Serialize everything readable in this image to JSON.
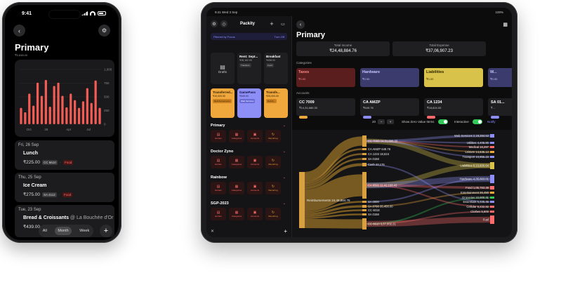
{
  "phone": {
    "status_time": "9:41",
    "title": "Primary",
    "subtitle": "₹5,638.00",
    "chart_data": {
      "type": "bar",
      "y_ticks": [
        "1,000",
        "750",
        "500",
        "250",
        "0"
      ],
      "x_ticks": [
        "Oct",
        "28",
        "Apr",
        "Jul"
      ],
      "values": [
        300,
        220,
        560,
        340,
        760,
        520,
        810,
        320,
        700,
        760,
        520,
        310,
        560,
        440,
        300,
        420,
        660,
        390,
        800,
        300
      ]
    },
    "transactions": [
      {
        "date": "Fri, 26 Sep",
        "name": "Lunch",
        "merchant": "",
        "amount": "₹225.00",
        "account": "CC 6610",
        "category": "Food"
      },
      {
        "date": "Thu, 25 Sep",
        "name": "Ice Cream",
        "merchant": "",
        "amount": "₹275.00",
        "account": "SA 4112",
        "category": "Food"
      },
      {
        "date": "Tue, 23 Sep",
        "name": "Bread & Croissants",
        "merchant": "@ La Bouchée d'Or",
        "amount": "₹439.00",
        "account": "",
        "category": ""
      }
    ],
    "tabs": [
      "All",
      "Month",
      "Week"
    ],
    "add_label": "+"
  },
  "tablet": {
    "status_time": "9:41",
    "status_date": "Wed 3 Sep",
    "status_battery": "100%",
    "sidebar": {
      "title": "Packity",
      "filter_label": "Filtered by Focus",
      "filter_off": "Turn Off",
      "drafts_label": "Drafts",
      "tiles_row1": [
        {
          "name": "Rent: Sept...",
          "amount": "₹28,162.00",
          "pill": "Transfers"
        },
        {
          "name": "Breakfast",
          "amount": "₹408.00",
          "pill": "Food"
        }
      ],
      "tiles_row2": [
        {
          "name": "Transferred...",
          "amount": "₹10,000.00",
          "pill": "Reimbursements",
          "style": "orange"
        },
        {
          "name": "GamePass",
          "amount": "₹349.00",
          "pill": "Web Services",
          "style": "purple"
        },
        {
          "name": "Transfe...",
          "amount": "₹25,000.00",
          "pill": "Reimb...",
          "style": "orange"
        }
      ],
      "groups": [
        "Primary",
        "Doctor Zyno",
        "Rainbow",
        "SGP-2023"
      ],
      "group_buttons": [
        "Entries",
        "Categories",
        "Accounts",
        "Recurring"
      ],
      "bottom_add": "+"
    },
    "main": {
      "title": "Primary",
      "total_income_label": "Total Income",
      "total_income": "₹24,48,884.76",
      "total_expense_label": "Total Expense",
      "total_expense": "₹37,06,907.23",
      "categories_label": "Categories",
      "categories": [
        {
          "name": "Taxes",
          "value": "₹0.00",
          "bg": "#5a1e1e",
          "fg": "#ff8a8a"
        },
        {
          "name": "Hardware",
          "value": "₹0.00",
          "bg": "#3b3b6e",
          "fg": "#c8c8ff"
        },
        {
          "name": "Liabilities",
          "value": "₹0.00",
          "bg": "#d9c24a",
          "fg": "#2a2300"
        },
        {
          "name": "W...",
          "value": "₹0.00",
          "bg": "#3b3b6e",
          "fg": "#c8c8ff"
        }
      ],
      "accounts_label": "Accounts",
      "accounts": [
        {
          "name": "CC 7009",
          "value": "₹14,31,680.33",
          "color": "#f0a73c"
        },
        {
          "name": "CA AMZP",
          "value": "₹649.76",
          "color": "#8e8ef7"
        },
        {
          "name": "CA 1234",
          "value": "₹18,624.00",
          "color": "#ff6b6b"
        },
        {
          "name": "SA 01...",
          "value": "₹...",
          "color": "#8e8ef7"
        }
      ],
      "controls": {
        "stepper_value": "20",
        "minus": "−",
        "plus": "+",
        "show_zero": "Show Zero Value Items",
        "interactive": "Interactive",
        "notify": "Notify"
      },
      "sankey": {
        "source": "Reimbursements 24,48,884.76",
        "accounts": [
          {
            "label": "CC 7009 14,31,680.33"
          },
          {
            "label": "CA AMZP 649.76"
          },
          {
            "label": "CA 1234 18,624"
          },
          {
            "label": "SA 0158"
          },
          {
            "label": "Cash 23,176"
          },
          {
            "label": "CA 6591 11,42,168.43"
          },
          {
            "label": "SA 0000"
          },
          {
            "label": "SA 8788 35,456.00"
          },
          {
            "label": "CC 6018"
          },
          {
            "label": "SA 0158"
          },
          {
            "label": "CC 6610 3,37,002.21"
          }
        ],
        "categories": [
          {
            "label": "Web Services 2,19,284.53"
          },
          {
            "label": "Utilities 4,405.80"
          },
          {
            "label": "Medical 18,297"
          },
          {
            "label": "Leisure 14,635.13"
          },
          {
            "label": "Transport 10,855.23"
          },
          {
            "label": "Liabilities 8,10,800.64"
          },
          {
            "label": "Hardware 4,35,663.01"
          },
          {
            "label": "Food 1,05,783.38"
          },
          {
            "label": "Entertainment 26,450"
          },
          {
            "label": "Groceries 22,000.31"
          },
          {
            "label": "Essentials 5,225.45"
          },
          {
            "label": "Cellular 5,232.92"
          },
          {
            "label": "Clothes 5,800"
          },
          {
            "label": "Fuel"
          }
        ]
      }
    }
  }
}
